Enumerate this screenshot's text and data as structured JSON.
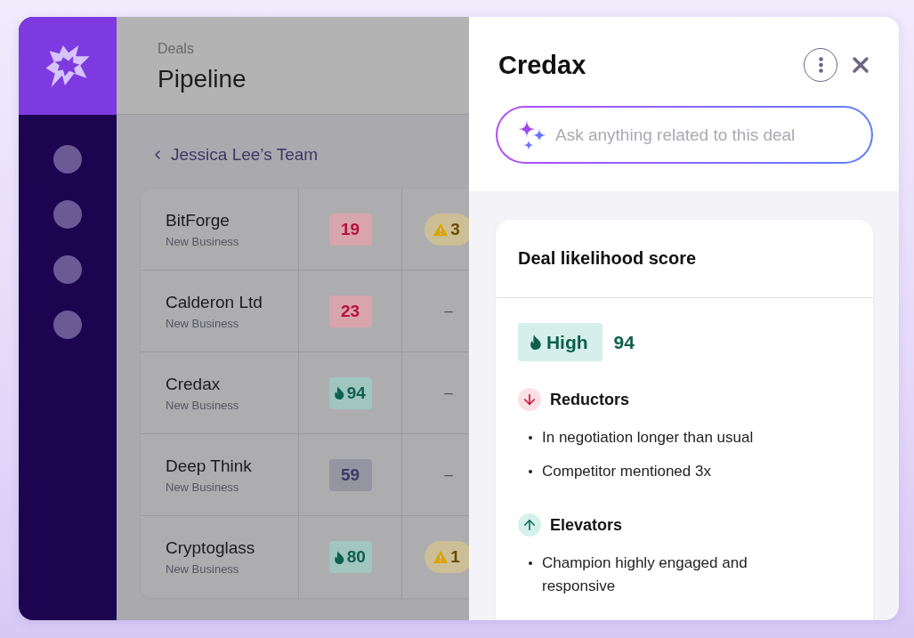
{
  "sidebar": {
    "nav_items": [
      {
        "kind": "dot"
      },
      {
        "kind": "dot"
      },
      {
        "kind": "dot"
      },
      {
        "kind": "dot"
      }
    ]
  },
  "header": {
    "section": "Deals",
    "title": "Pipeline"
  },
  "breadcrumb": {
    "label": "Jessica Lee’s Team"
  },
  "table": {
    "rows": [
      {
        "name": "BitForge",
        "type": "New Business",
        "score": {
          "kind": "low",
          "value": "19"
        },
        "column_3": {
          "kind": "warning",
          "text": "3"
        }
      },
      {
        "name": "Calderon Ltd",
        "type": "New Business",
        "score": {
          "kind": "low",
          "value": "23"
        },
        "column_3": {
          "kind": "dash",
          "text": "–"
        }
      },
      {
        "name": "Credax",
        "type": "New Business",
        "score": {
          "kind": "high",
          "value": "94"
        },
        "column_3": {
          "kind": "dash",
          "text": "–"
        }
      },
      {
        "name": "Deep Think",
        "type": "New Business",
        "score": {
          "kind": "medium",
          "value": "59"
        },
        "column_3": {
          "kind": "dash",
          "text": "–"
        }
      },
      {
        "name": "Cryptoglass",
        "type": "New Business",
        "score": {
          "kind": "high",
          "value": "80"
        },
        "column_3": {
          "kind": "warning",
          "text": "1"
        }
      }
    ]
  },
  "panel": {
    "title": "Credax",
    "ask": {
      "placeholder": "Ask anything related to this deal"
    },
    "score_card": {
      "title": "Deal likelihood score",
      "kind": "high",
      "label": "High",
      "score": "94",
      "factors": [
        {
          "kind": "reductor",
          "title": "Reductors",
          "items": [
            "In negotiation longer than usual",
            "Competitor mentioned 3x"
          ]
        },
        {
          "kind": "elevator",
          "title": "Elevators",
          "items": [
            "Champion highly engaged and responsive"
          ]
        }
      ]
    }
  }
}
